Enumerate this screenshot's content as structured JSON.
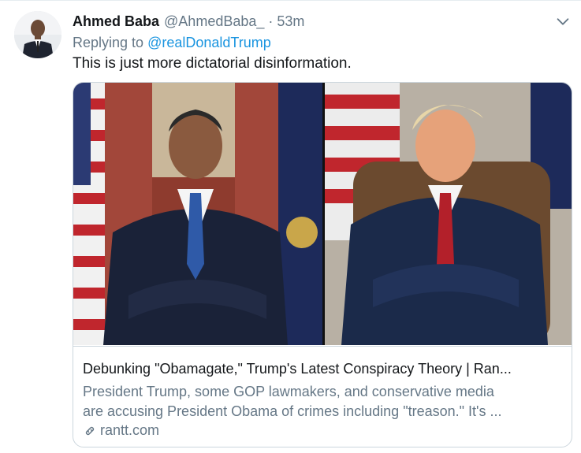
{
  "tweet": {
    "display_name": "Ahmed Baba",
    "handle": "@AhmedBaba_",
    "separator": "·",
    "timestamp": "53m",
    "reply_prefix": "Replying to",
    "reply_mention": "@realDonaldTrump",
    "text": "This is just more dictatorial disinformation."
  },
  "card": {
    "title": "Debunking \"Obamagate,\" Trump's Latest Conspiracy Theory | Ran...",
    "description_line1": "President Trump, some GOP lawmakers, and conservative media",
    "description_line2": "are accusing President Obama of crimes including \"treason.\" It's ...",
    "domain": "rantt.com",
    "link_icon": "link-icon"
  },
  "colors": {
    "name": "#14171a",
    "secondary": "#657786",
    "link": "#1b95e0",
    "border": "#ccd6dd"
  },
  "icons": [
    "chevron-down-icon",
    "link-icon",
    "avatar"
  ]
}
